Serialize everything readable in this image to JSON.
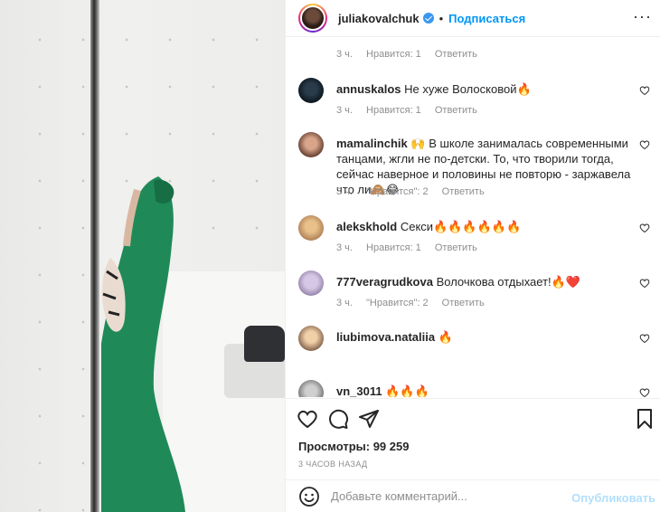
{
  "post": {
    "username": "juliakovalchuk",
    "separator": "•",
    "follow_label": "Подписаться",
    "more_label": "···"
  },
  "top_meta": {
    "time": "3 ч.",
    "likes": "Нравится: 1",
    "reply": "Ответить"
  },
  "comments": [
    {
      "username": "annuskalos",
      "text": "Не хуже Волосковой",
      "emoji": "🔥",
      "time": "3 ч.",
      "likes": "Нравится: 1",
      "reply": "Ответить"
    },
    {
      "username": "mamalinchik",
      "emoji_lead": "🙌",
      "text": "В школе занималась современными танцами, жгли не по-детски. То, что творили тогда, сейчас наверное и половины не повторю - заржавела что ли",
      "emoji": "🙈😂",
      "time": "3 ч.",
      "likes": "\"Нравится\": 2",
      "reply": "Ответить"
    },
    {
      "username": "alekskhold",
      "text": "Секси",
      "emoji": "🔥🔥🔥🔥🔥🔥",
      "time": "3 ч.",
      "likes": "Нравится: 1",
      "reply": "Ответить"
    },
    {
      "username": "777veragrudkova",
      "text": "Волочкова отдыхает!",
      "emoji": "🔥❤️",
      "time": "3 ч.",
      "likes": "\"Нравится\": 2",
      "reply": "Ответить"
    },
    {
      "username": "liubimova.nataliia",
      "text": "",
      "emoji": "🔥",
      "time": "",
      "likes": "",
      "reply": ""
    },
    {
      "username": "vn_3011",
      "text": "",
      "emoji": "🔥🔥🔥",
      "time": "",
      "likes": "",
      "reply": ""
    }
  ],
  "views": "Просмотры: 99 259",
  "time_ago": "3 ЧАСОВ НАЗАД",
  "add_comment": {
    "placeholder": "Добавьте комментарий...",
    "publish_label": "Опубликовать"
  }
}
